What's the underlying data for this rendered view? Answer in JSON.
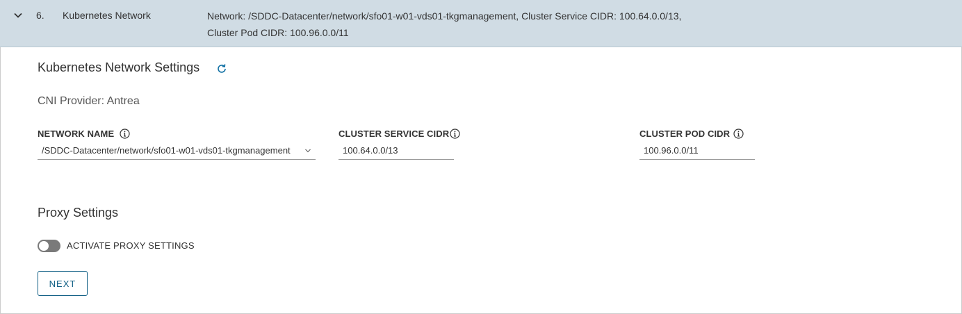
{
  "step": {
    "number": "6.",
    "title": "Kubernetes Network",
    "summary": "Network: /SDDC-Datacenter/network/sfo01-w01-vds01-tkgmanagement, Cluster Service CIDR: 100.64.0.0/13, Cluster Pod CIDR: 100.96.0.0/11",
    "expanded": true
  },
  "network_settings": {
    "title": "Kubernetes Network Settings",
    "cni_provider": "CNI Provider: Antrea",
    "network_name": {
      "label": "NETWORK NAME",
      "value": "/SDDC-Datacenter/network/sfo01-w01-vds01-tkgmanagement"
    },
    "cluster_service_cidr": {
      "label": "CLUSTER SERVICE CIDR",
      "value": "100.64.0.0/13"
    },
    "cluster_pod_cidr": {
      "label": "CLUSTER POD CIDR",
      "value": "100.96.0.0/11"
    }
  },
  "proxy_settings": {
    "title": "Proxy Settings",
    "toggle_label": "ACTIVATE PROXY SETTINGS",
    "toggle_on": false
  },
  "actions": {
    "next_label": "NEXT"
  },
  "colors": {
    "header_bg": "#d0dce4",
    "accent": "#0e5d83",
    "toggle_off": "#7a7a7a"
  }
}
